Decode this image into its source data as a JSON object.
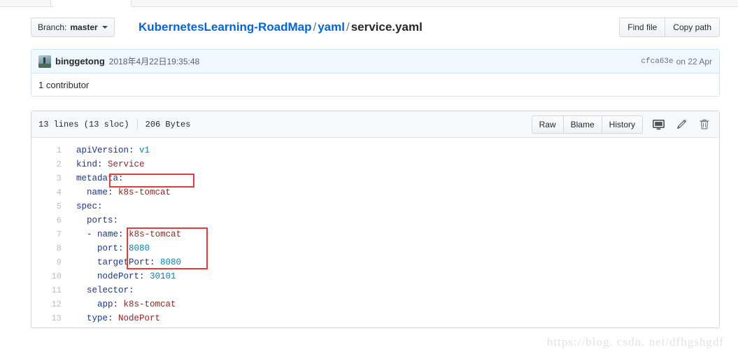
{
  "header": {
    "branch_button": {
      "prefix": "Branch:",
      "name": "master"
    },
    "breadcrumb": {
      "repo": "KubernetesLearning-RoadMap",
      "sep": "/",
      "folder": "yaml",
      "file": "service.yaml"
    },
    "actions": {
      "find_file": "Find file",
      "copy_path": "Copy path"
    }
  },
  "commit": {
    "author": "binggetong",
    "date": "2018年4月22日19:35:48",
    "hash": "cfca63e",
    "hash_suffix": "on 22 Apr",
    "contributors": "1 contributor"
  },
  "blob": {
    "lines_label": "13 lines (13 sloc)",
    "size_label": "206 Bytes",
    "buttons": {
      "raw": "Raw",
      "blame": "Blame",
      "history": "History"
    },
    "icons": {
      "desktop": "desktop-download-icon",
      "edit": "pencil-icon",
      "delete": "trash-icon"
    }
  },
  "code": {
    "language": "yaml",
    "lines": [
      {
        "n": "1",
        "indent": 0,
        "tokens": [
          {
            "t": "apiVersion:",
            "c": "k"
          },
          {
            "t": " ",
            "c": "p"
          },
          {
            "t": "v1",
            "c": "v"
          }
        ]
      },
      {
        "n": "2",
        "indent": 0,
        "tokens": [
          {
            "t": "kind:",
            "c": "k"
          },
          {
            "t": " ",
            "c": "p"
          },
          {
            "t": "Service",
            "c": "str"
          }
        ]
      },
      {
        "n": "3",
        "indent": 0,
        "tokens": [
          {
            "t": "metadata:",
            "c": "k"
          }
        ]
      },
      {
        "n": "4",
        "indent": 1,
        "tokens": [
          {
            "t": "name:",
            "c": "k"
          },
          {
            "t": " ",
            "c": "p"
          },
          {
            "t": "k8s-tomcat",
            "c": "str"
          }
        ]
      },
      {
        "n": "5",
        "indent": 0,
        "tokens": [
          {
            "t": "spec:",
            "c": "k"
          }
        ]
      },
      {
        "n": "6",
        "indent": 1,
        "tokens": [
          {
            "t": "ports:",
            "c": "k"
          }
        ]
      },
      {
        "n": "7",
        "indent": 1,
        "tokens": [
          {
            "t": "- ",
            "c": "p"
          },
          {
            "t": "name:",
            "c": "k"
          },
          {
            "t": " ",
            "c": "p"
          },
          {
            "t": "k8s-tomcat",
            "c": "str"
          }
        ]
      },
      {
        "n": "8",
        "indent": 2,
        "tokens": [
          {
            "t": "port:",
            "c": "k"
          },
          {
            "t": " ",
            "c": "p"
          },
          {
            "t": "8080",
            "c": "v"
          }
        ]
      },
      {
        "n": "9",
        "indent": 2,
        "tokens": [
          {
            "t": "targetPort:",
            "c": "k"
          },
          {
            "t": " ",
            "c": "p"
          },
          {
            "t": "8080",
            "c": "v"
          }
        ]
      },
      {
        "n": "10",
        "indent": 2,
        "tokens": [
          {
            "t": "nodePort:",
            "c": "k"
          },
          {
            "t": " ",
            "c": "p"
          },
          {
            "t": "30101",
            "c": "v"
          }
        ]
      },
      {
        "n": "11",
        "indent": 1,
        "tokens": [
          {
            "t": "selector:",
            "c": "k"
          }
        ]
      },
      {
        "n": "12",
        "indent": 2,
        "tokens": [
          {
            "t": "app:",
            "c": "k"
          },
          {
            "t": " ",
            "c": "p"
          },
          {
            "t": "k8s-tomcat",
            "c": "str"
          }
        ]
      },
      {
        "n": "13",
        "indent": 1,
        "tokens": [
          {
            "t": "type:",
            "c": "k"
          },
          {
            "t": " ",
            "c": "p"
          },
          {
            "t": "NodePort",
            "c": "str"
          }
        ]
      }
    ]
  },
  "annotations": [
    {
      "label": "name-highlight",
      "color": "#e33a3a"
    },
    {
      "label": "ports-highlight",
      "color": "#e33a3a"
    }
  ],
  "watermark": "https://blog. csdn. net/dfhgshgdf"
}
